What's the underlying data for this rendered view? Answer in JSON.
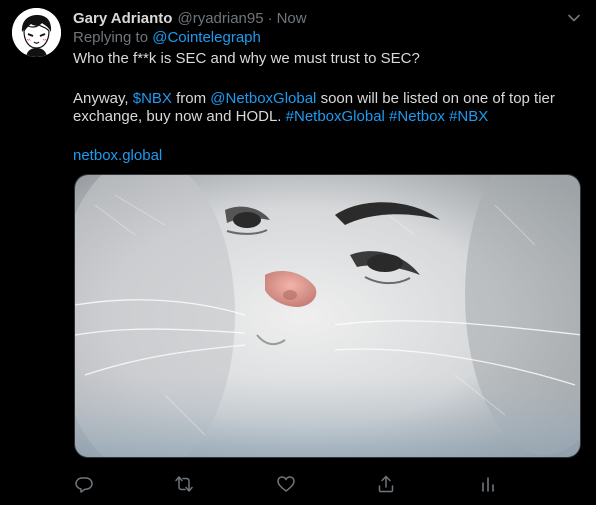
{
  "tweet": {
    "display_name": "Gary Adrianto",
    "handle": "@ryadrian95",
    "separator": "·",
    "time": "Now",
    "replying_prefix": "Replying to",
    "replying_to": "@Cointelegraph",
    "line1": "Who the f**k is SEC and why we must trust to SEC?",
    "line2": {
      "prefix": "Anyway, ",
      "cashtag": "$NBX",
      "mid": " from ",
      "mention": "@NetboxGlobal",
      "suffix": " soon will be listed on one of top tier"
    },
    "line3": {
      "text": "exchange, buy now and HODL. ",
      "tag1": "#NetboxGlobal",
      "tag2": "#Netbox",
      "tag3": "#NBX"
    },
    "link": "netbox.global"
  },
  "icons": {
    "menu": "chevron-down-icon",
    "reply": "reply-icon",
    "retweet": "retweet-icon",
    "like": "heart-icon",
    "share": "share-icon",
    "analytics": "analytics-icon"
  },
  "colors": {
    "background": "#000000",
    "text": "#d9d9d9",
    "secondary": "#6e767d",
    "link": "#1d9bf0"
  }
}
